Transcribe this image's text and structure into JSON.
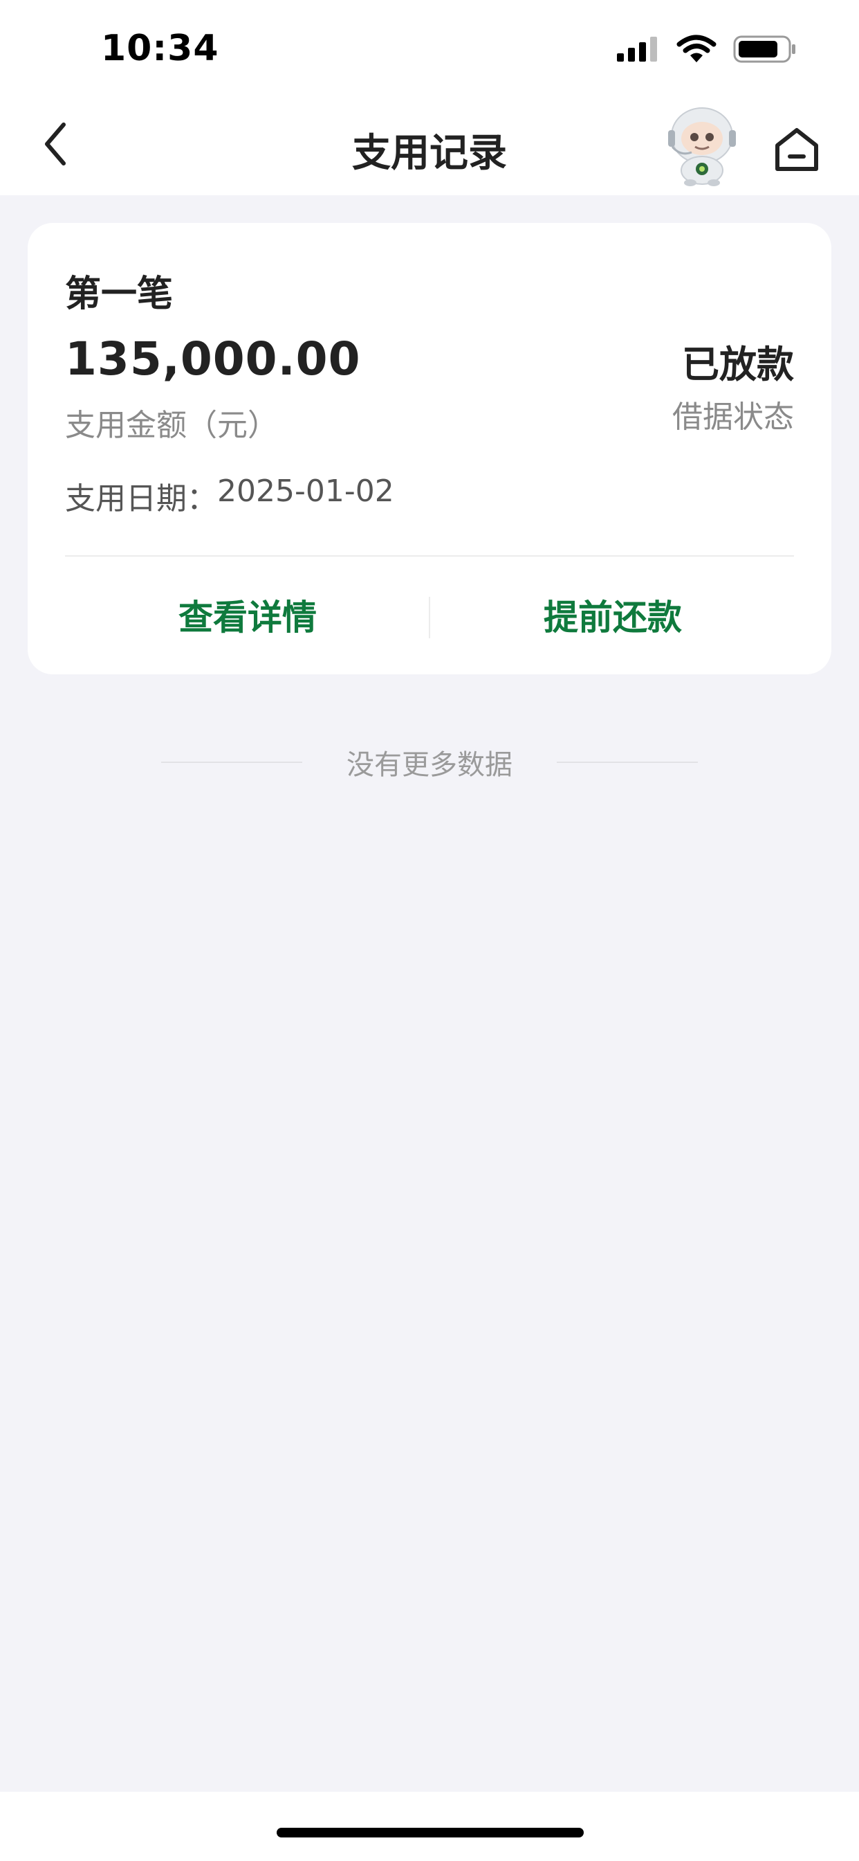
{
  "status_bar": {
    "time": "10:34",
    "icons": [
      "signal-icon",
      "wifi-icon",
      "battery-icon"
    ]
  },
  "nav": {
    "title": "支用记录",
    "back_icon": "chevron-left-icon",
    "mascot": "robot-mascot",
    "home_icon": "home-icon"
  },
  "card": {
    "title": "第一笔",
    "amount": "135,000.00",
    "amount_label": "支用金额（元）",
    "status_value": "已放款",
    "status_label": "借据状态",
    "date_label": "支用日期：",
    "date_value": "2025-01-02",
    "actions": {
      "details": "查看详情",
      "prepay": "提前还款"
    }
  },
  "footer": {
    "no_more": "没有更多数据"
  },
  "colors": {
    "accent_green": "#0f7a3d",
    "page_bg": "#f3f3f8",
    "card_bg": "#ffffff"
  }
}
